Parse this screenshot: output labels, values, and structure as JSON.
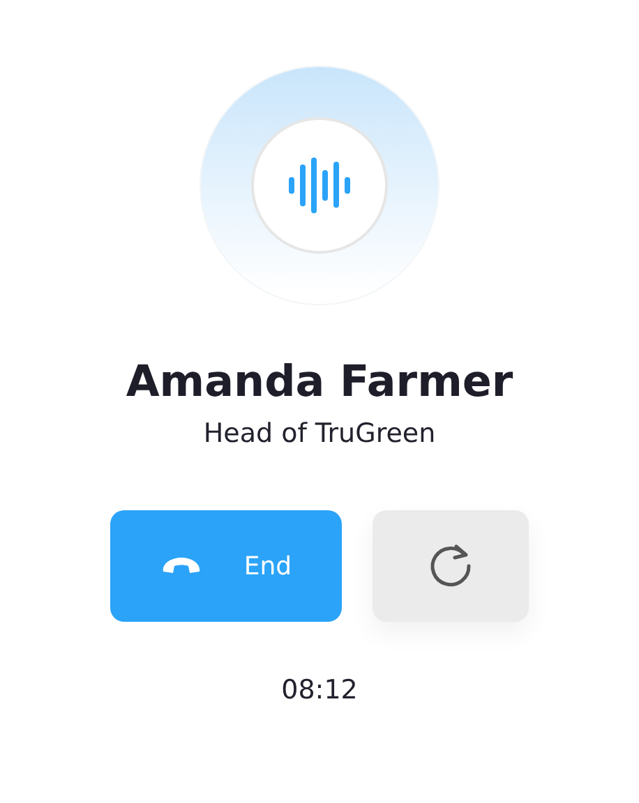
{
  "contact": {
    "name": "Amanda Farmer",
    "title": "Head of TruGreen"
  },
  "buttons": [
    {
      "kind": "end",
      "label": "End"
    },
    {
      "kind": "refresh"
    }
  ],
  "timer": "08:12"
}
